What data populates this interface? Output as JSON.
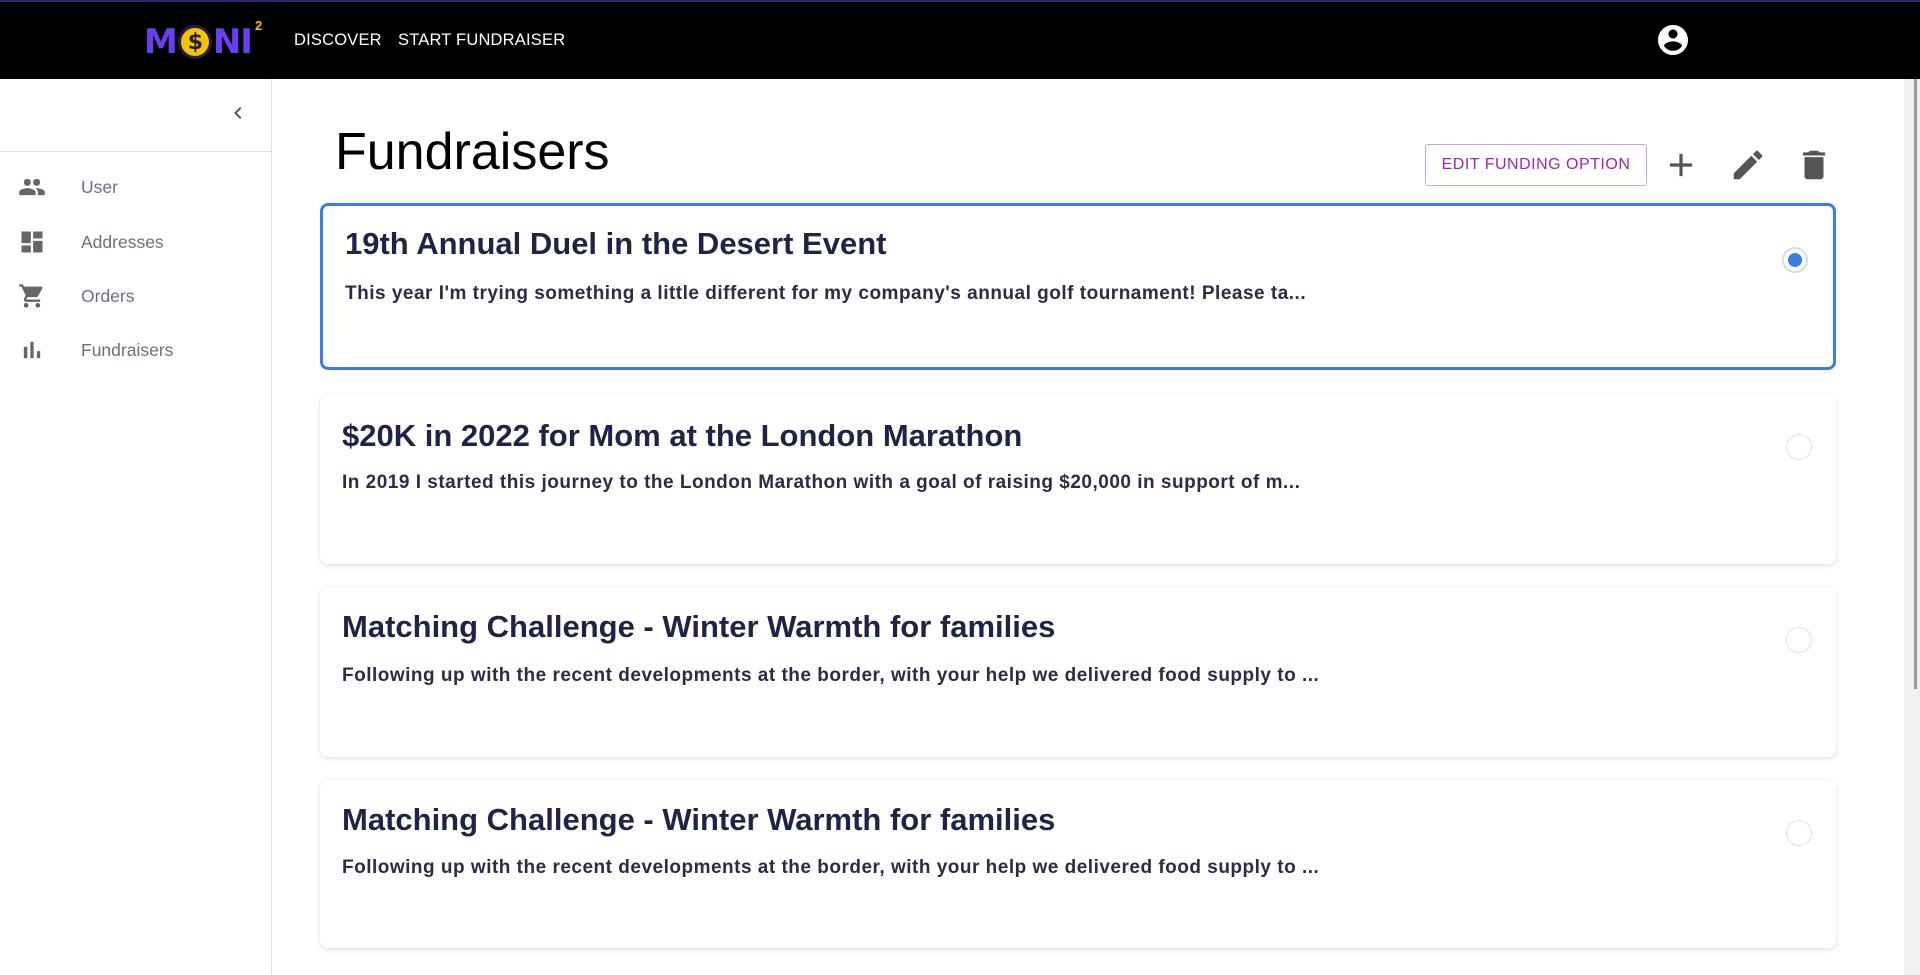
{
  "header": {
    "logo": {
      "text_left": "M",
      "coin_glyph": "$",
      "text_right": "NI",
      "superscript": "2"
    },
    "nav": [
      {
        "label": "DISCOVER"
      },
      {
        "label": "START FUNDRAISER"
      }
    ],
    "account_icon": "account-circle-icon"
  },
  "sidebar": {
    "collapse_icon": "chevron-left-icon",
    "items": [
      {
        "label": "User",
        "icon": "people-icon"
      },
      {
        "label": "Addresses",
        "icon": "dashboard-icon"
      },
      {
        "label": "Orders",
        "icon": "shopping-cart-icon"
      },
      {
        "label": "Fundraisers",
        "icon": "bar-chart-icon"
      }
    ]
  },
  "main": {
    "title": "Fundraisers",
    "toolbar": {
      "edit_funding_label": "EDIT FUNDING OPTION",
      "icons": [
        "add-icon",
        "edit-icon",
        "delete-icon"
      ]
    },
    "fundraisers": [
      {
        "title": "19th Annual Duel in the Desert Event",
        "description": "This year I'm trying something a little different for my company's annual golf tournament! Please ta...",
        "selected": true
      },
      {
        "title": "$20K in 2022 for Mom at the London Marathon",
        "description": "In 2019 I started this journey to the London Marathon with a goal of raising $20,000 in support of m...",
        "selected": false
      },
      {
        "title": "Matching Challenge - Winter Warmth for families",
        "description": "Following up with the recent developments at the border, with your help we delivered food supply to ...",
        "selected": false
      },
      {
        "title": "Matching Challenge - Winter Warmth for families",
        "description": "Following up with the recent developments at the border, with your help we delivered food supply to ...",
        "selected": false
      }
    ]
  },
  "colors": {
    "topbar": "#000000",
    "brand_purple": "#6b3ef0",
    "brand_yellow": "#f4c400",
    "selected_border": "#3a7ee4",
    "button_purple": "#9c27b0"
  }
}
